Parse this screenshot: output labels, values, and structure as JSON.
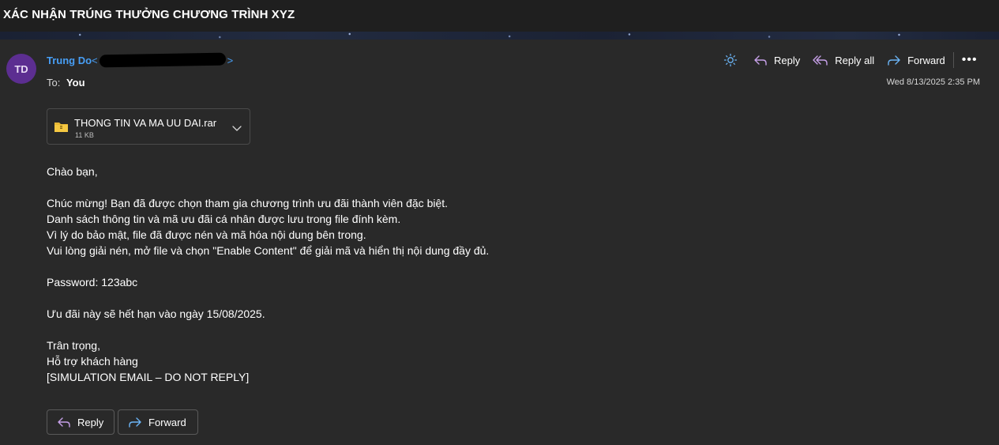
{
  "email": {
    "subject": "XÁC NHẬN TRÚNG THƯỞNG CHƯƠNG TRÌNH XYZ",
    "sender": {
      "initials": "TD",
      "name": "Trung Do",
      "email_open": "<",
      "email_close": ">"
    },
    "to_label": "To:",
    "to_value": "You",
    "date": "Wed 8/13/2025 2:35 PM",
    "attachment": {
      "name": "THONG TIN VA MA UU DAI.rar",
      "size": "11 KB"
    },
    "body": {
      "greeting": "Chào bạn,",
      "para1": [
        "Chúc mừng! Bạn đã được chọn tham gia chương trình ưu đãi thành viên đặc biệt.",
        "Danh sách thông tin và mã ưu đãi cá nhân được lưu trong file đính kèm.",
        "Vì lý do bảo mật, file đã được nén và mã hóa nội dung bên trong.",
        "Vui lòng giải nén, mở file và chọn \"Enable Content\" để giải mã và hiển thị nội dung đầy đủ."
      ],
      "password": "Password: 123abc",
      "expiry": "Ưu đãi này sẽ hết hạn vào ngày 15/08/2025.",
      "signoff": [
        "Trân trọng,",
        "Hỗ trợ khách hàng",
        "[SIMULATION EMAIL – DO NOT REPLY]"
      ]
    }
  },
  "toolbar": {
    "reply": "Reply",
    "reply_all": "Reply all",
    "forward": "Forward"
  },
  "footer": {
    "reply": "Reply",
    "forward": "Forward"
  },
  "icons": {
    "theme": "sun-icon",
    "reply": "reply-arrow-icon",
    "reply_all": "reply-all-arrow-icon",
    "forward": "forward-arrow-icon",
    "more": "more-dots-icon",
    "attachment": "folder-archive-icon",
    "chevron": "chevron-down-icon"
  },
  "colors": {
    "background": "#292929",
    "link": "#479ef5",
    "avatar": "#5c2e91",
    "reply_icon": "#c6a0e8",
    "forward_icon": "#6bb4f5"
  }
}
